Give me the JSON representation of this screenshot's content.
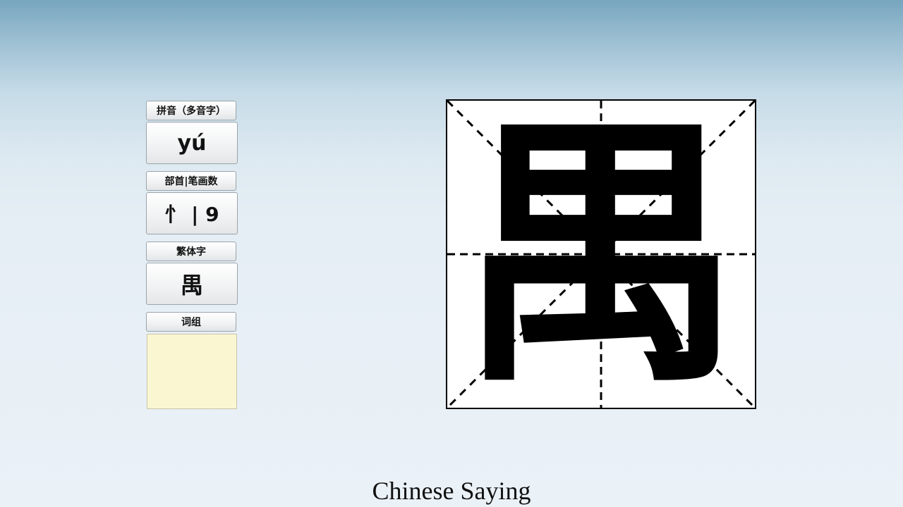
{
  "panel": {
    "pinyin": {
      "label": "拼音（多音字）",
      "value": "yú"
    },
    "radical_strokes": {
      "label": "部首|笔画数",
      "value": "忄 | 9"
    },
    "traditional": {
      "label": "繁体字",
      "value": "禺"
    },
    "words": {
      "label": "词组",
      "value": ""
    }
  },
  "character": {
    "glyph": "禺"
  },
  "caption": {
    "text": "Chinese Saying"
  }
}
